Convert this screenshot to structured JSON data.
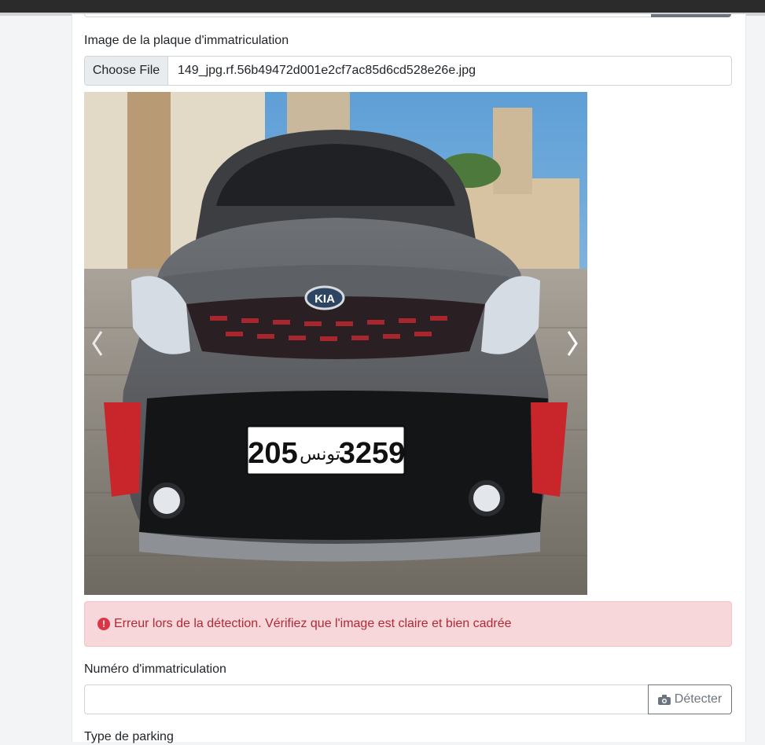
{
  "form": {
    "plate_image_label": "Image de la plaque d'immatriculation",
    "file_input": {
      "button_label": "Choose File",
      "file_name": "149_jpg.rf.56b49472d001e2cf7ac85d6cd528e26e.jpg"
    },
    "carousel": {
      "plate_text_left": "205",
      "plate_text_arabic": "تونس",
      "plate_text_right": "3259",
      "brand_badge": "KIA"
    },
    "alert": {
      "message": "Erreur lors de la détection. Vérifiez que l'image est claire et bien cadrée",
      "color": "#b02a37"
    },
    "plate_number_label": "Numéro d'immatriculation",
    "plate_number_value": "",
    "detect_button_label": "Détecter",
    "parking_type_label": "Type de parking"
  },
  "icons": {
    "alert": "exclamation-circle-icon",
    "detect": "camera-icon",
    "prev": "chevron-left-icon",
    "next": "chevron-right-icon"
  }
}
